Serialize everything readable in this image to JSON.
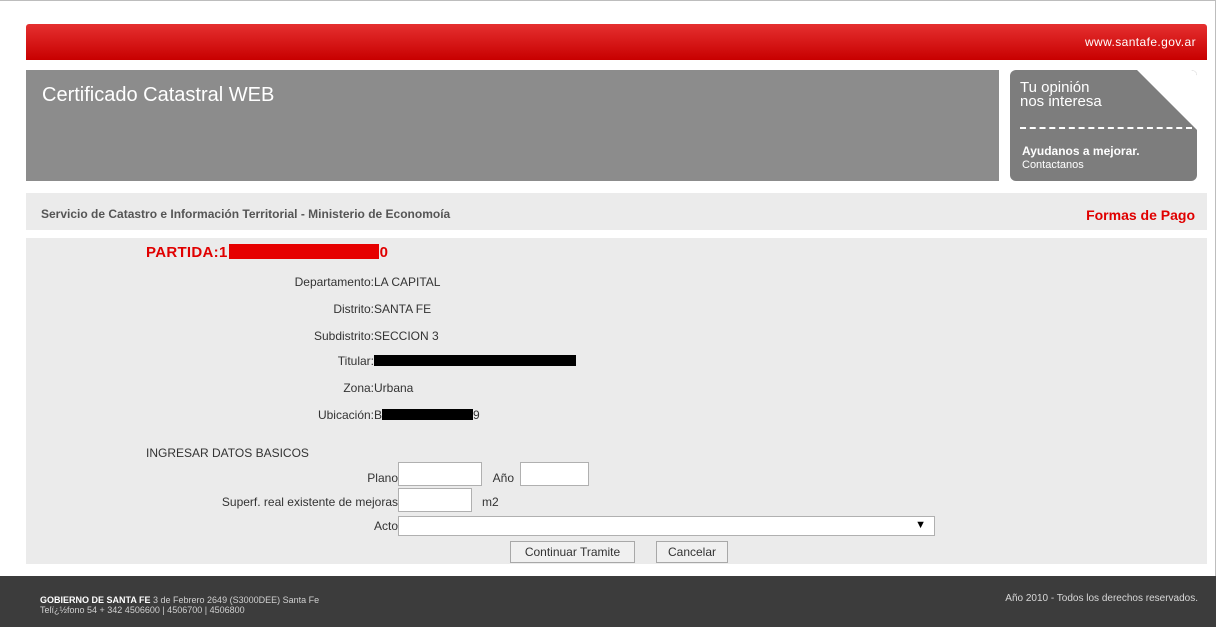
{
  "header": {
    "site_link": "www.santafe.gov.ar",
    "app_title": "Certificado Catastral WEB"
  },
  "opinion_box": {
    "line1": "Tu opinión",
    "line2": "nos interesa",
    "line3": "Ayudanos a mejorar.",
    "line4": "Contactanos"
  },
  "service_bar": {
    "text": "Servicio de Catastro e Información Territorial - Ministerio de Economoía",
    "link": "Formas de Pago"
  },
  "parcel": {
    "partida_prefix": "PARTIDA:1",
    "partida_suffix": "0",
    "fields": [
      {
        "label": "Departamento:",
        "value": "LA CAPITAL"
      },
      {
        "label": "Distrito:",
        "value": "SANTA FE"
      },
      {
        "label": "Subdistrito:",
        "value": "SECCION 3"
      },
      {
        "label": "Titular:",
        "value": ""
      },
      {
        "label": "Zona:",
        "value": "Urbana"
      },
      {
        "label": "Ubicación:",
        "value_prefix": "B",
        "value_suffix": "9"
      }
    ]
  },
  "form": {
    "section_title": "INGRESAR DATOS BASICOS",
    "plano_label": "Plano",
    "plano_value": "",
    "anio_label": "Año",
    "anio_value": "",
    "superf_label": "Superf. real existente de mejoras",
    "superf_value": "",
    "superf_unit": "m2",
    "acto_label": "Acto",
    "acto_selected": "",
    "continue_button": "Continuar Tramite",
    "cancel_button": "Cancelar"
  },
  "footer": {
    "org": "GOBIERNO DE SANTA FE",
    "address": " 3 de Febrero 2649 (S3000DEE) Santa Fe",
    "phone": "Telï¿½fono 54 + 342 4506600 | 4506700 | 4506800",
    "rights": "Año 2010 - Todos los derechos reservados."
  },
  "colors": {
    "brand_red": "#e00000",
    "banner_gray": "#8c8c8c",
    "footer_dark": "#3c3c3c"
  }
}
